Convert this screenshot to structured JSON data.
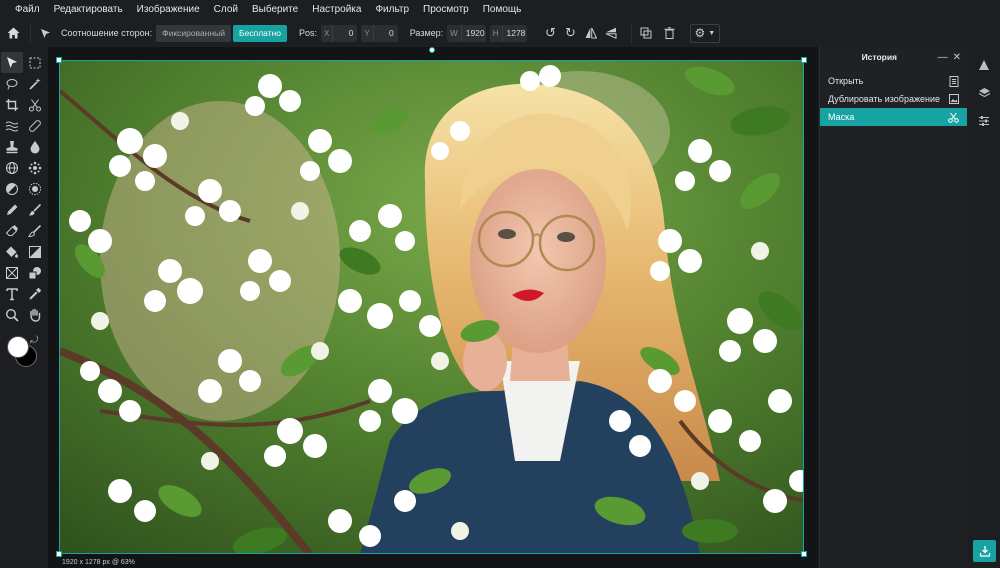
{
  "menu": {
    "items": [
      "Файл",
      "Редактировать",
      "Изображение",
      "Слой",
      "Выберите",
      "Настройка",
      "Фильтр",
      "Просмотр",
      "Помощь"
    ]
  },
  "options": {
    "aspect_label": "Соотношение сторон:",
    "aspect_fixed": "Фиксированный",
    "aspect_free": "Бесплатно",
    "pos_label": "Pos:",
    "x_prefix": "X",
    "x_value": "0",
    "y_prefix": "Y",
    "y_value": "0",
    "size_label": "Размер:",
    "w_prefix": "W",
    "w_value": "1920",
    "h_prefix": "H",
    "h_value": "1278"
  },
  "history": {
    "title": "История",
    "items": [
      {
        "label": "Открыть",
        "icon": "document-icon",
        "selected": false
      },
      {
        "label": "Дублировать изображение",
        "icon": "image-icon",
        "selected": false
      },
      {
        "label": "Маска",
        "icon": "scissors-icon",
        "selected": true
      }
    ]
  },
  "status": {
    "text": "1920 x 1278 px @ 63%"
  },
  "colors": {
    "accent": "#18a3a3",
    "foreground": "#ffffff",
    "background": "#000000"
  },
  "canvas": {
    "content": "photo"
  }
}
